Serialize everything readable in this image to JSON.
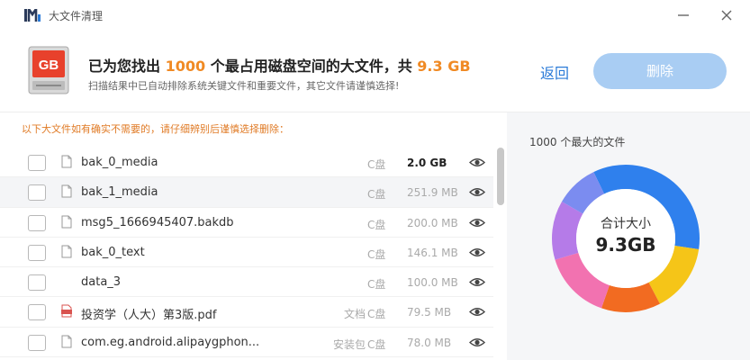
{
  "app": {
    "title": "大文件清理"
  },
  "header": {
    "headline_prefix": "已为您找出",
    "headline_count": "1000",
    "headline_middle": "个最占用磁盘空间的大文件，共",
    "headline_total": "9.3 GB",
    "subline": "扫描结果中已自动排除系统关键文件和重要文件，其它文件请谨慎选择!",
    "back_label": "返回",
    "delete_label": "删除",
    "icon_text": "GB"
  },
  "list": {
    "note": "以下大文件如有确实不需要的，请仔细辨别后谨慎选择删除：",
    "rows": [
      {
        "name": "bak_0_media",
        "type": "",
        "drive": "C盘",
        "size": "2.0 GB",
        "icon": "file-icon",
        "big": true
      },
      {
        "name": "bak_1_media",
        "type": "",
        "drive": "C盘",
        "size": "251.9 MB",
        "icon": "file-icon",
        "big": false
      },
      {
        "name": "msg5_1666945407.bakdb",
        "type": "",
        "drive": "C盘",
        "size": "200.0 MB",
        "icon": "file-icon",
        "big": false
      },
      {
        "name": "bak_0_text",
        "type": "",
        "drive": "C盘",
        "size": "146.1 MB",
        "icon": "file-icon",
        "big": false
      },
      {
        "name": "data_3",
        "type": "",
        "drive": "C盘",
        "size": "100.0 MB",
        "icon": "none",
        "big": false
      },
      {
        "name": "投资学（人大）第3版.pdf",
        "type": "文档",
        "drive": "C盘",
        "size": "79.5 MB",
        "icon": "pdf-icon",
        "big": false
      },
      {
        "name": "com.eg.android.alipaygphon...",
        "type": "安装包",
        "drive": "C盘",
        "size": "78.0 MB",
        "icon": "file-icon",
        "big": false
      }
    ]
  },
  "side": {
    "title": "1000 个最大的文件",
    "center_label": "合计大小",
    "center_value": "9.3GB"
  },
  "colors": {
    "accent": "#f08a24",
    "primary": "#2b7bd8",
    "delete_disabled": "#a9cdf3",
    "donut": [
      "#2f80ed",
      "#f5c518",
      "#f26b21",
      "#f272b0",
      "#b57be8",
      "#7b8cf0"
    ]
  },
  "donut_shares": [
    0.345,
    0.15,
    0.13,
    0.15,
    0.13,
    0.095
  ]
}
